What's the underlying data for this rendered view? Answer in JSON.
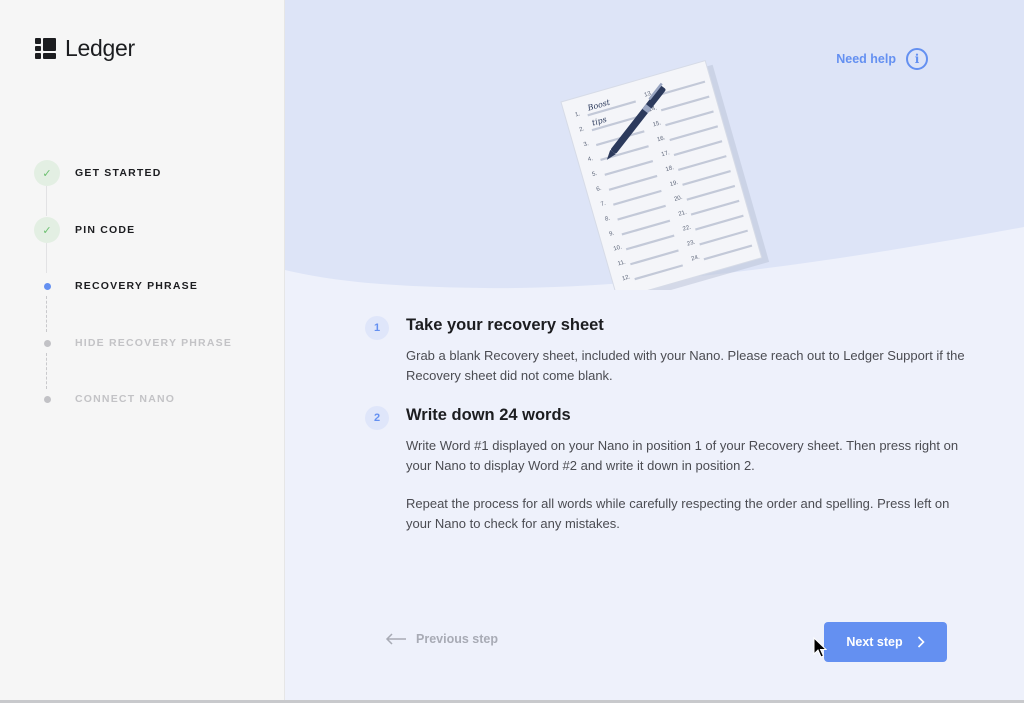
{
  "app": {
    "name": "Ledger"
  },
  "sidebar": {
    "steps": [
      {
        "label": "GET STARTED",
        "state": "done"
      },
      {
        "label": "PIN CODE",
        "state": "done"
      },
      {
        "label": "RECOVERY PHRASE",
        "state": "current"
      },
      {
        "label": "HIDE RECOVERY PHRASE",
        "state": "todo"
      },
      {
        "label": "CONNECT NANO",
        "state": "todo"
      }
    ],
    "check_glyph": "✓"
  },
  "header": {
    "need_help": "Need help",
    "help_icon_glyph": "i"
  },
  "illustration": {
    "left_numbers": [
      "1.",
      "2.",
      "3.",
      "4.",
      "5.",
      "6.",
      "7.",
      "8.",
      "9.",
      "10.",
      "11.",
      "12."
    ],
    "right_numbers": [
      "13.",
      "14.",
      "15.",
      "16.",
      "17.",
      "18.",
      "19.",
      "20.",
      "21.",
      "22.",
      "23.",
      "24."
    ],
    "handwritten_words": [
      "Boost",
      "tips"
    ]
  },
  "instructions": [
    {
      "number": "1",
      "title": "Take your recovery sheet",
      "paragraphs": [
        "Grab a blank Recovery sheet, included with your Nano. Please reach out to Ledger Support if the Recovery sheet did not come blank."
      ]
    },
    {
      "number": "2",
      "title": "Write down 24 words",
      "paragraphs": [
        "Write Word #1 displayed on your Nano in position 1 of your Recovery sheet. Then press right on your Nano to display Word #2 and write it down in position 2.",
        "Repeat the process for all words while carefully respecting the order and spelling. Press left on your Nano to check for any mistakes."
      ]
    }
  ],
  "footer": {
    "previous_step": "Previous step",
    "next_step": "Next step"
  },
  "colors": {
    "accent": "#6490f1",
    "success": "#6cc070",
    "sidebar_bg": "#f6f6f6",
    "main_bg": "#eef1fb",
    "hero_bg": "#dde4f7"
  }
}
